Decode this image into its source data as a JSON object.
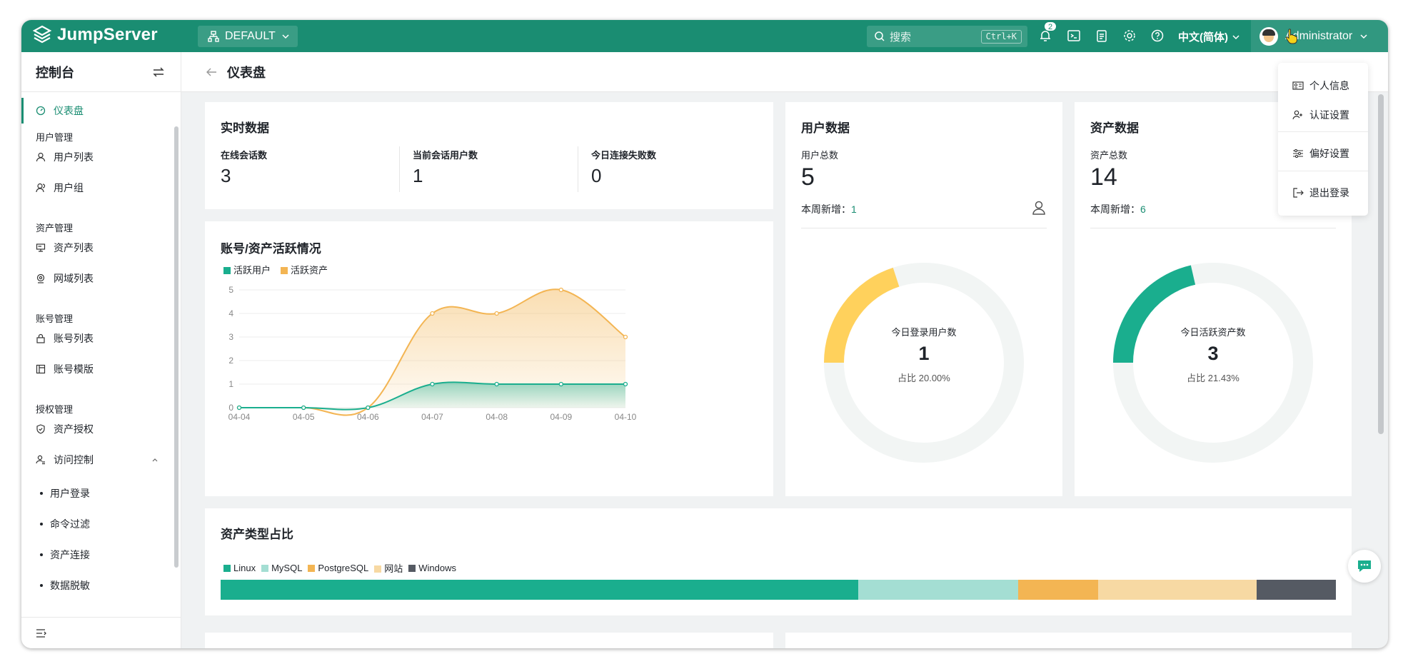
{
  "app": {
    "logo_text": "JumpServer",
    "org": "DEFAULT"
  },
  "topnav": {
    "search_placeholder": "搜索",
    "search_shortcut": "Ctrl+K",
    "notification_count": "2",
    "language": "中文(简体)",
    "user_name": "Administrator"
  },
  "user_menu": {
    "profile": "个人信息",
    "auth_settings": "认证设置",
    "preferences": "偏好设置",
    "logout": "退出登录"
  },
  "sidebar": {
    "title": "控制台",
    "dashboard": "仪表盘",
    "group_user": "用户管理",
    "user_list": "用户列表",
    "user_group": "用户组",
    "group_asset": "资产管理",
    "asset_list": "资产列表",
    "domain_list": "网域列表",
    "group_account": "账号管理",
    "account_list": "账号列表",
    "account_template": "账号模版",
    "group_perm": "授权管理",
    "asset_perm": "资产授权",
    "access_control": "访问控制",
    "sub_user_login": "用户登录",
    "sub_cmd_filter": "命令过滤",
    "sub_asset_conn": "资产连接",
    "sub_data_mask": "数据脱敏"
  },
  "page": {
    "title": "仪表盘"
  },
  "realtime": {
    "title": "实时数据",
    "online_sessions_label": "在线会话数",
    "online_sessions": "3",
    "session_users_label": "当前会话用户数",
    "session_users": "1",
    "failed_label": "今日连接失败数",
    "failed": "0"
  },
  "user_data": {
    "title": "用户数据",
    "total_label": "用户总数",
    "total": "5",
    "weekly_label": "本周新增：",
    "weekly": "1",
    "donut_label": "今日登录用户数",
    "donut_value": "1",
    "donut_pct": "占比 20.00%",
    "ratio": 0.2,
    "color": "#ffd15c"
  },
  "asset_data": {
    "title": "资产数据",
    "total_label": "资产总数",
    "total": "14",
    "weekly_label": "本周新增：",
    "weekly": "6",
    "donut_label": "今日活跃资产数",
    "donut_value": "3",
    "donut_pct": "占比 21.43%",
    "ratio": 0.2143,
    "color": "#1aae8e"
  },
  "activity": {
    "title": "账号/资产活跃情况",
    "legend_users": "活跃用户",
    "legend_assets": "活跃资产"
  },
  "asset_types": {
    "title": "资产类型占比",
    "items": [
      {
        "name": "Linux",
        "color": "#1aae8e",
        "share": 0.572
      },
      {
        "name": "MySQL",
        "color": "#a4ded3",
        "share": 0.143
      },
      {
        "name": "PostgreSQL",
        "color": "#f3b553",
        "share": 0.072
      },
      {
        "name": "网站",
        "color": "#f7d9a3",
        "share": 0.142
      },
      {
        "name": "Windows",
        "color": "#555a63",
        "share": 0.071
      }
    ]
  },
  "chart_data": {
    "type": "area",
    "title": "账号/资产活跃情况",
    "categories": [
      "04-04",
      "04-05",
      "04-06",
      "04-07",
      "04-08",
      "04-09",
      "04-10"
    ],
    "series": [
      {
        "name": "活跃用户",
        "color": "#1aae8e",
        "values": [
          0,
          0,
          0,
          1,
          1,
          1,
          1
        ]
      },
      {
        "name": "活跃资产",
        "color": "#f3b553",
        "values": [
          0,
          0,
          0,
          4,
          4,
          5,
          3
        ]
      }
    ],
    "yticks": [
      "0",
      "1",
      "2",
      "3",
      "4",
      "5"
    ],
    "ylim": [
      0,
      5
    ],
    "grid": true,
    "legend": "top-left"
  }
}
